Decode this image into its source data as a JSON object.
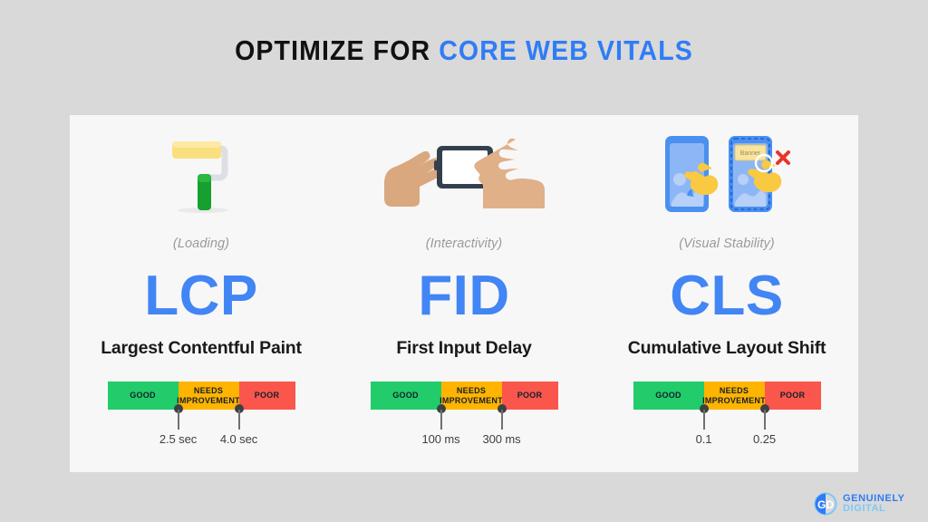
{
  "title": {
    "lead": "OPTIMIZE FOR ",
    "accent": "CORE WEB VITALS"
  },
  "colors": {
    "background": "#D9D9D9",
    "card": "#F7F7F7",
    "accent_blue": "#4285F4",
    "title_blue": "#2F7CF6",
    "good": "#22CC6A",
    "needs_improvement": "#FFB400",
    "poor": "#FA564C",
    "tick": "#3C4043",
    "sublabel_gray": "#9A9A9A",
    "heading_black": "#1A1A1A"
  },
  "metrics": [
    {
      "icon_name": "paint-roller-icon",
      "sublabel": "(Loading)",
      "acronym": "LCP",
      "fullname": "Largest Contentful Paint",
      "bar": {
        "segments": [
          {
            "label": "GOOD",
            "color": "#22CC6A"
          },
          {
            "label": "NEEDS IMPROVEMENT",
            "color": "#FFB400"
          },
          {
            "label": "POOR",
            "color": "#FA564C"
          }
        ],
        "thresholds": [
          {
            "value": "2.5 sec"
          },
          {
            "value": "4.0 sec"
          }
        ]
      }
    },
    {
      "icon_name": "hands-tapping-phone-icon",
      "sublabel": "(Interactivity)",
      "acronym": "FID",
      "fullname": "First Input Delay",
      "bar": {
        "segments": [
          {
            "label": "GOOD",
            "color": "#22CC6A"
          },
          {
            "label": "NEEDS IMPROVEMENT",
            "color": "#FFB400"
          },
          {
            "label": "POOR",
            "color": "#FA564C"
          }
        ],
        "thresholds": [
          {
            "value": "100 ms"
          },
          {
            "value": "300 ms"
          }
        ]
      }
    },
    {
      "icon_name": "layout-shift-banner-icon",
      "sublabel": "(Visual Stability)",
      "acronym": "CLS",
      "fullname": "Cumulative Layout Shift",
      "banner_label": "Banner",
      "bar": {
        "segments": [
          {
            "label": "GOOD",
            "color": "#22CC6A"
          },
          {
            "label": "NEEDS IMPROVEMENT",
            "color": "#FFB400"
          },
          {
            "label": "POOR",
            "color": "#FA564C"
          }
        ],
        "thresholds": [
          {
            "value": "0.1"
          },
          {
            "value": "0.25"
          }
        ]
      }
    }
  ],
  "logo": {
    "monogram": "GD",
    "line1": "GENUINELY",
    "line2": "DIGITAL"
  }
}
